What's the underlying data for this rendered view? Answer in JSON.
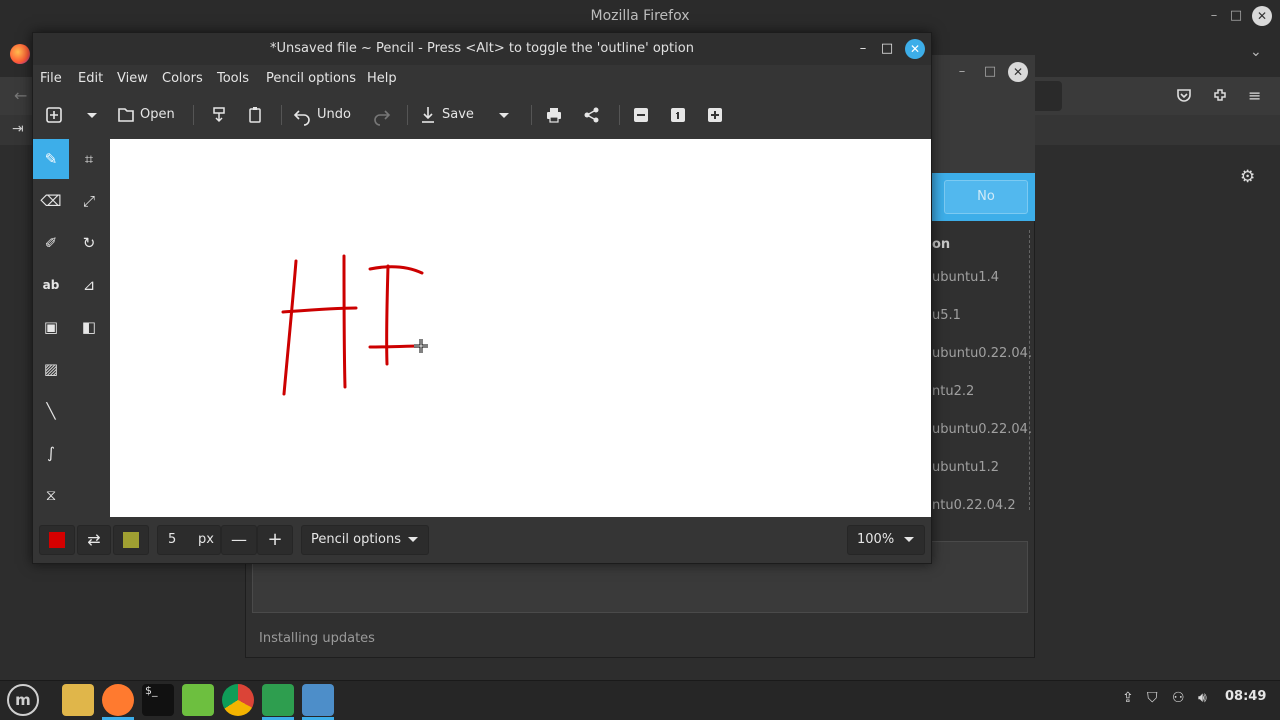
{
  "firefox": {
    "title": "Mozilla Firefox",
    "min": "–",
    "max": "□",
    "close": "✕"
  },
  "updater": {
    "no_label": "No",
    "column_header": "on",
    "rows": [
      "ubuntu1.4",
      "u5.1",
      "ubuntu0.22.04.",
      "ntu2.2",
      "ubuntu0.22.04.",
      "ubuntu1.2",
      "ntu0.22.04.2"
    ],
    "status": "Installing updates"
  },
  "pencil": {
    "title": "*Unsaved file ~ Pencil - Press <Alt> to toggle the 'outline' option",
    "min": "–",
    "max": "□",
    "close": "✕",
    "menu": [
      "File",
      "Edit",
      "View",
      "Colors",
      "Tools",
      "Pencil options",
      "Help"
    ],
    "toolbar": {
      "open": "Open",
      "undo": "Undo",
      "save": "Save"
    },
    "bottom": {
      "size_value": "5",
      "size_unit": "px",
      "options_label": "Pencil options",
      "zoom": "100%",
      "main_color": "#d40000",
      "secondary_color": "#a0a032"
    }
  },
  "taskbar": {
    "clock": "08:49"
  }
}
